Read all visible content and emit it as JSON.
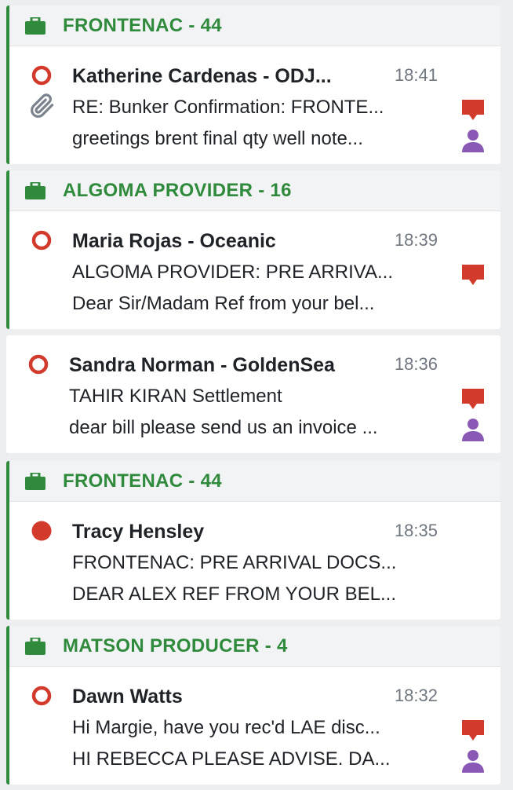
{
  "colors": {
    "group_accent": "#2f8a3c",
    "status_red": "#d23a2c",
    "comment_red": "#d23a2c",
    "person_purple": "#8a59b5",
    "attachment_gray": "#7a828c"
  },
  "groups": [
    {
      "title": "FRONTENAC - 44",
      "messages": [
        {
          "sender": "Katherine Cardenas - ODJ...",
          "time": "18:41",
          "subject": "RE: Bunker Confirmation: FRONTE...",
          "preview": "greetings brent final qty well note...",
          "status": "unread",
          "icons": [
            "attachment-icon",
            "comment-icon",
            "person-icon"
          ]
        }
      ]
    },
    {
      "title": "ALGOMA PROVIDER - 16",
      "messages": [
        {
          "sender": "Maria Rojas - Oceanic",
          "time": "18:39",
          "subject": "ALGOMA PROVIDER: PRE ARRIVA...",
          "preview": "Dear Sir/Madam Ref from your bel...",
          "status": "unread",
          "icons": [
            "comment-icon"
          ]
        }
      ]
    },
    {
      "title": "",
      "messages": [
        {
          "sender": "Sandra Norman - GoldenSea",
          "time": "18:36",
          "subject": "TAHIR KIRAN Settlement",
          "preview": "dear bill please send us an invoice ...",
          "status": "unread",
          "icons": [
            "comment-icon",
            "person-icon"
          ]
        }
      ]
    },
    {
      "title": "FRONTENAC - 44",
      "messages": [
        {
          "sender": "Tracy Hensley",
          "time": "18:35",
          "subject": "FRONTENAC: PRE ARRIVAL DOCS...",
          "preview": "DEAR ALEX REF FROM YOUR BEL...",
          "status": "flagged",
          "icons": []
        }
      ]
    },
    {
      "title": "MATSON PRODUCER - 4",
      "messages": [
        {
          "sender": "Dawn Watts",
          "time": "18:32",
          "subject": "Hi Margie, have you rec'd LAE disc...",
          "preview": "HI REBECCA PLEASE ADVISE. DA...",
          "status": "unread",
          "icons": [
            "comment-icon",
            "person-icon"
          ]
        }
      ]
    }
  ]
}
